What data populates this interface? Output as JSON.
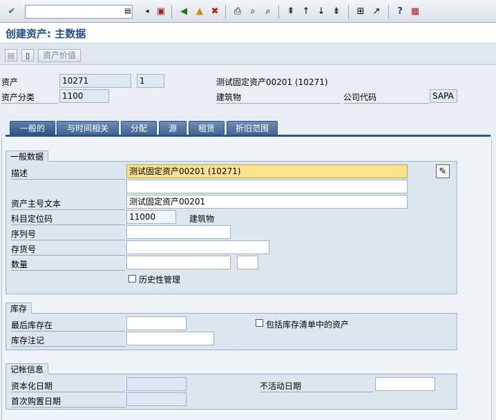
{
  "toolbar": {
    "command_field": "",
    "icons": [
      "checkmark-icon",
      "save-icon",
      "back-icon",
      "exit-icon",
      "cancel-icon",
      "print-icon",
      "find-icon",
      "find-next-icon",
      "first-page-icon",
      "prev-page-icon",
      "next-page-icon",
      "last-page-icon",
      "create-session-icon",
      "shortcut-icon",
      "help-icon",
      "customize-layout-icon"
    ]
  },
  "header": {
    "title": "创建资产: 主数据"
  },
  "app_toolbar": {
    "asset_value_label": "资产价值"
  },
  "asset": {
    "asset_label": "资产",
    "asset_number": "10271",
    "sub_number": "1",
    "description": "测试固定资产00201 (10271)",
    "class_label": "资产分类",
    "class_value": "1100",
    "class_text": "建筑物",
    "company_label": "公司代码",
    "company_value": "SAPA"
  },
  "tabs": [
    {
      "label": "一般的",
      "active": true
    },
    {
      "label": "与时间相关"
    },
    {
      "label": "分配"
    },
    {
      "label": "源"
    },
    {
      "label": "租赁"
    },
    {
      "label": "折旧范围"
    }
  ],
  "general": {
    "group_title": "一般数据",
    "description_label": "描述",
    "description_value": "测试固定资产00201 (10271)",
    "description2_value": "",
    "main_text_label": "资产主号文本",
    "main_text_value": "测试固定资产00201",
    "account_label": "科目定位码",
    "account_value": "11000",
    "account_text": "建筑物",
    "serial_label": "序列号",
    "serial_value": "",
    "inventory_label": "存货号",
    "inventory_value": "",
    "quantity_label": "数量",
    "quantity_value": "",
    "unit_value": "",
    "history_label": "历史性管理"
  },
  "inventory": {
    "group_title": "库存",
    "last_label": "最后库存在",
    "last_value": "",
    "note_label": "库存注记",
    "note_value": "",
    "include_label": "包括库存清单中的资产"
  },
  "posting": {
    "group_title": "记帐信息",
    "cap_label": "资本化日期",
    "cap_value": "",
    "inactive_label": "不活动日期",
    "inactive_value": "",
    "first_label": "首次购置日期",
    "first_value": ""
  }
}
